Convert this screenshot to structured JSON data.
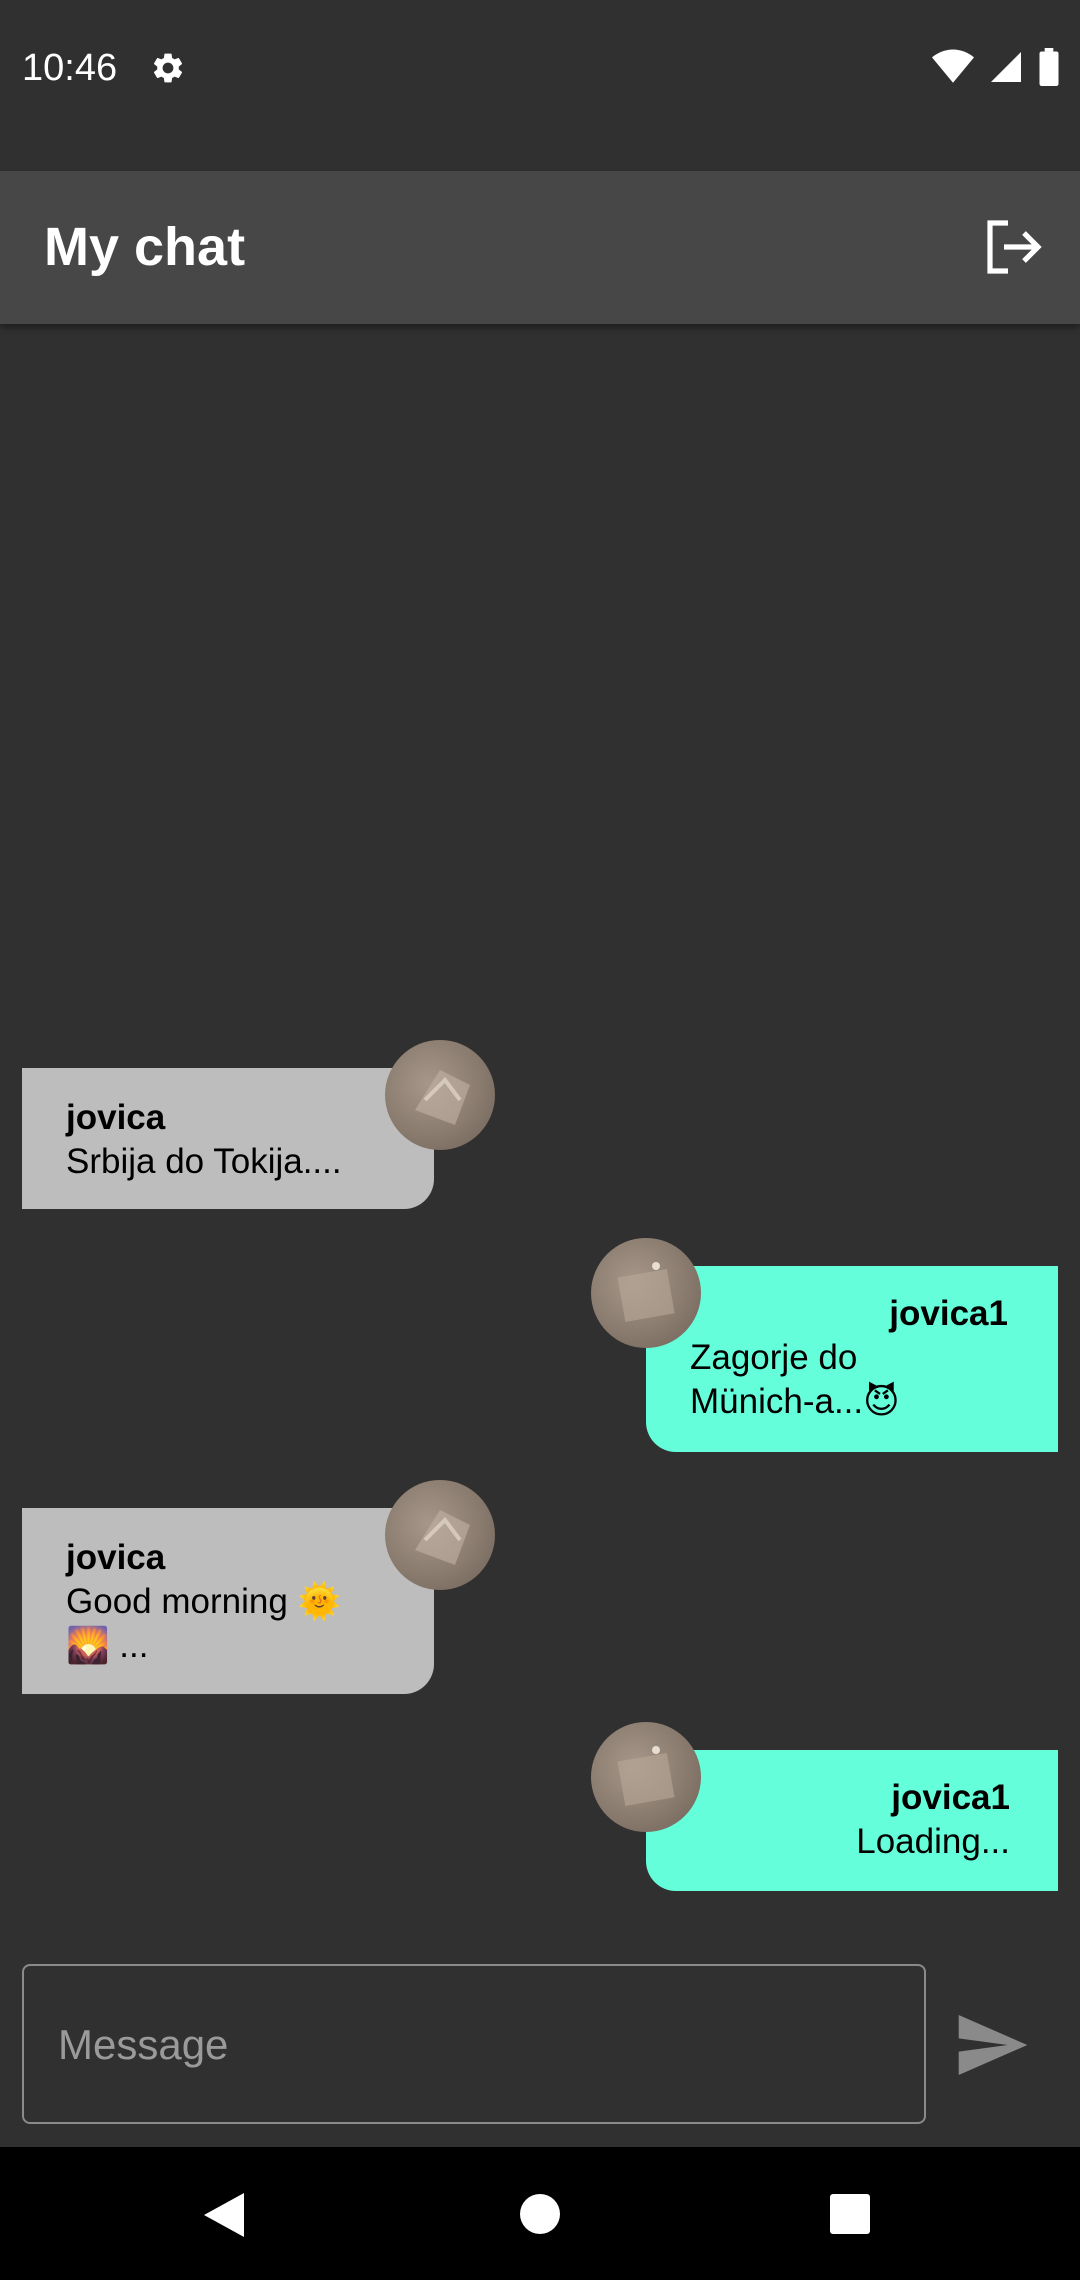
{
  "status_bar": {
    "time": "10:46",
    "icons": [
      "gear-icon",
      "wifi-icon",
      "signal-icon",
      "battery-icon"
    ]
  },
  "app_bar": {
    "title": "My chat",
    "logout_icon": "logout-icon"
  },
  "messages": [
    {
      "direction": "incoming",
      "sender": "jovica",
      "lines": [
        "Srbija do Tokija...."
      ]
    },
    {
      "direction": "outgoing",
      "sender": "jovica1",
      "lines": [
        "Zagorje do",
        "Münich-a...😈"
      ]
    },
    {
      "direction": "incoming",
      "sender": "jovica",
      "lines": [
        "Good morning 🌞",
        "🌄 ..."
      ]
    },
    {
      "direction": "outgoing",
      "sender": "jovica1",
      "lines": [
        "Loading..."
      ]
    }
  ],
  "composer": {
    "placeholder": "Message",
    "value": "",
    "send_icon": "send-icon"
  },
  "nav_bar": {
    "icons": [
      "back-icon",
      "home-icon",
      "recents-icon"
    ]
  },
  "colors": {
    "background": "#303030",
    "app_bar": "#474747",
    "incoming_bubble": "#bdbdbd",
    "outgoing_bubble": "#64ffda"
  }
}
